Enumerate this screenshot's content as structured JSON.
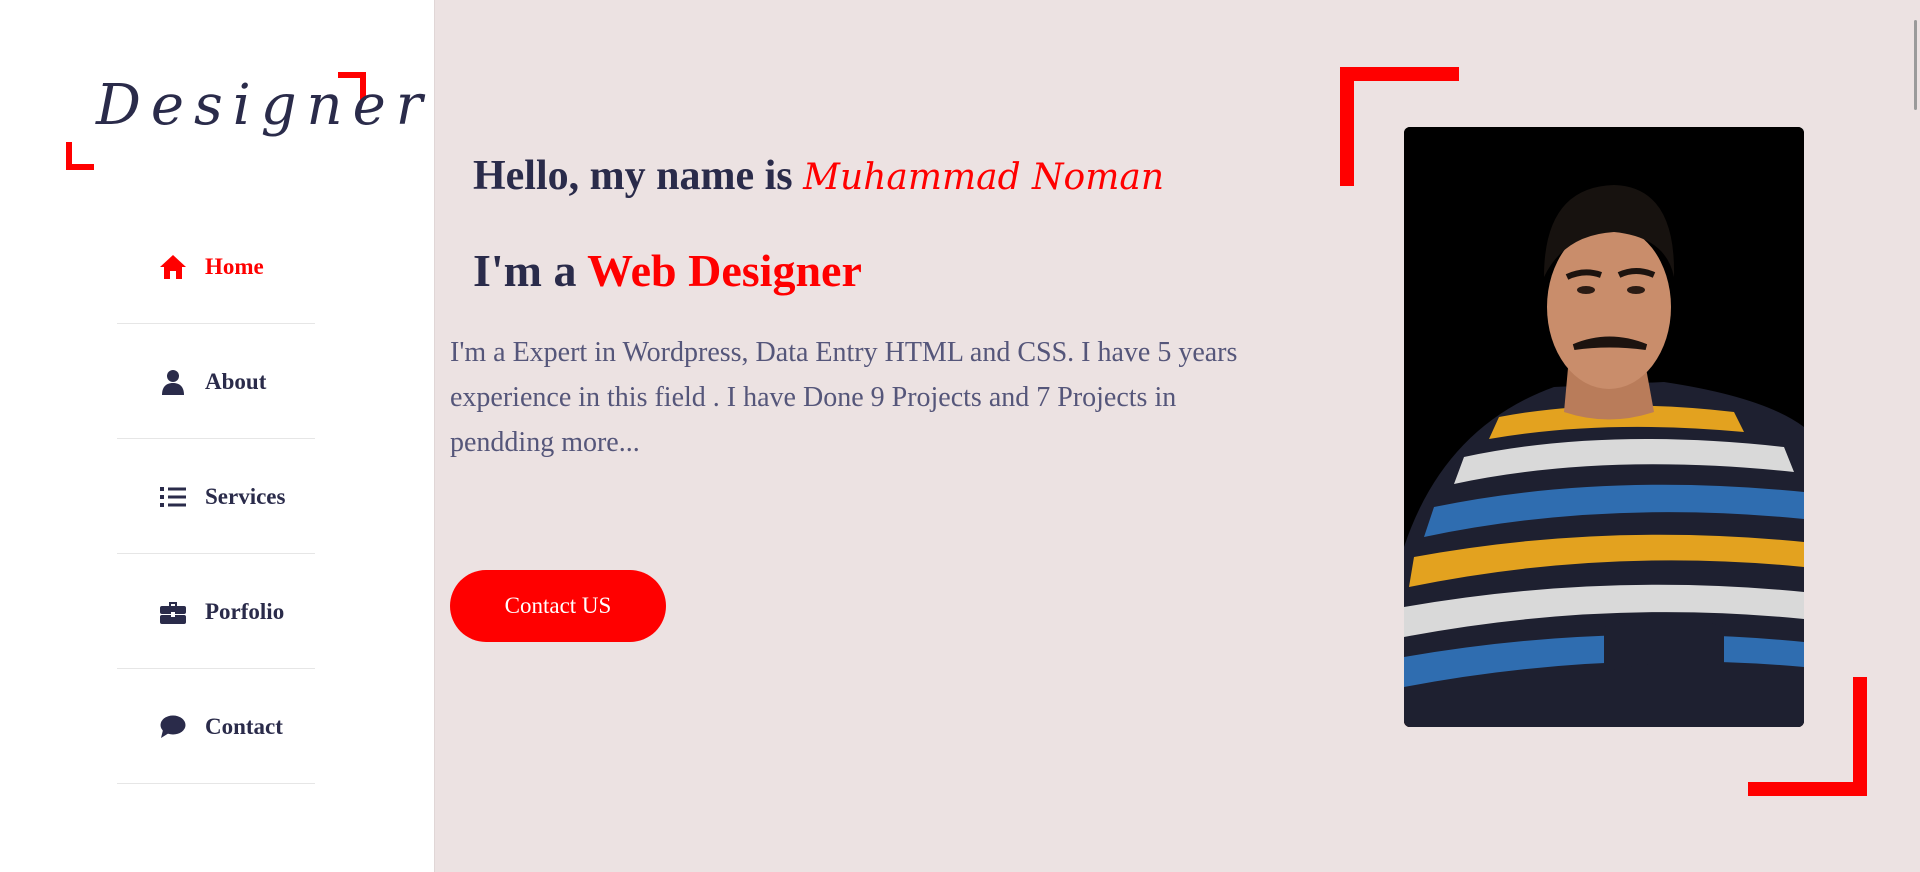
{
  "logo": {
    "text": "Designer"
  },
  "nav": {
    "items": [
      {
        "label": "Home",
        "icon": "home-icon",
        "active": true
      },
      {
        "label": "About",
        "icon": "user-icon",
        "active": false
      },
      {
        "label": "Services",
        "icon": "list-icon",
        "active": false
      },
      {
        "label": "Porfolio",
        "icon": "briefcase-icon",
        "active": false
      },
      {
        "label": "Contact",
        "icon": "chat-icon",
        "active": false
      }
    ]
  },
  "hero": {
    "greeting": "Hello, my name is ",
    "name": "Muhammad Noman",
    "role_prefix": "I'm a ",
    "role": "Web Designer",
    "description": "I'm a Expert in Wordpress, Data Entry HTML and CSS. I have 5 years experience in this field . I have Done 9 Projects and 7 Projects in pendding more...",
    "cta_label": "Contact US"
  },
  "colors": {
    "accent": "#ff0000",
    "text_dark": "#2a2b4a",
    "text_muted": "#55567a",
    "main_bg": "#ece2e2",
    "sidebar_bg": "#ffffff"
  }
}
